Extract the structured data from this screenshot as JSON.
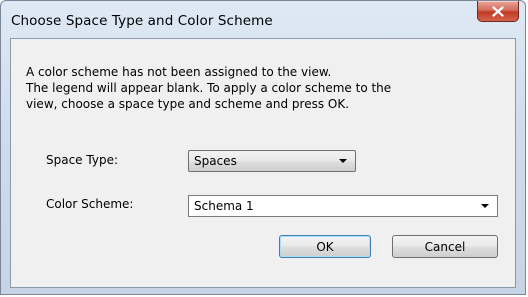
{
  "window": {
    "title": "Choose Space Type and Color Scheme",
    "close_icon": "close-x-icon"
  },
  "message": {
    "lines": [
      "A color scheme has not been assigned to the view.",
      "The legend will appear blank.  To apply a color scheme to the",
      "view, choose a space type and scheme and press OK."
    ]
  },
  "form": {
    "space_type_label": "Space Type:",
    "space_type_value": "Spaces",
    "color_scheme_label": "Color Scheme:",
    "color_scheme_value": "Schema 1"
  },
  "buttons": {
    "ok_label": "OK",
    "cancel_label": "Cancel"
  }
}
